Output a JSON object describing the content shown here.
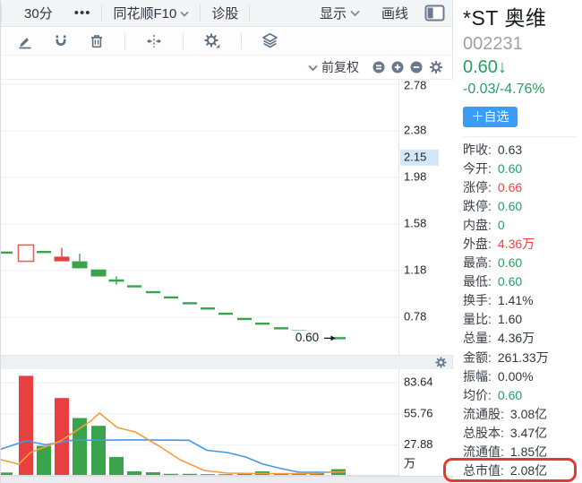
{
  "toolbar": {
    "interval": "30分",
    "more": "•••",
    "f10": "同花顺F10",
    "diagnose": "诊股",
    "display": "显示",
    "drawline": "画线",
    "draw_icons": [
      "pen-icon",
      "magnet-icon",
      "trash-icon",
      "split-arrows-icon",
      "gear-icon",
      "layers-icon"
    ]
  },
  "chart_header": {
    "adjust_label": "前复权",
    "zoom_icons": [
      "equals-circle-icon",
      "plus-circle-icon",
      "minus-circle-icon",
      "gear-icon"
    ]
  },
  "right_panel": {
    "name": "*ST 奥维",
    "code": "002231",
    "price": "0.60",
    "price_arrow": "↓",
    "change": "-0.03/-4.76%",
    "fav_button": "＋自选",
    "stats": [
      {
        "label": "昨收:",
        "value": "0.63",
        "color": "dark"
      },
      {
        "label": "今开:",
        "value": "0.60",
        "color": "green"
      },
      {
        "label": "涨停:",
        "value": "0.66",
        "color": "red"
      },
      {
        "label": "跌停:",
        "value": "0.60",
        "color": "green"
      },
      {
        "label": "内盘:",
        "value": "0",
        "color": "green"
      },
      {
        "label": "外盘:",
        "value": "4.36万",
        "color": "red"
      },
      {
        "label": "最高:",
        "value": "0.60",
        "color": "green"
      },
      {
        "label": "最低:",
        "value": "0.60",
        "color": "green"
      },
      {
        "label": "换手:",
        "value": "1.41%",
        "color": "dark"
      },
      {
        "label": "量比:",
        "value": "1.60",
        "color": "dark"
      },
      {
        "label": "总量:",
        "value": "4.36万",
        "color": "dark"
      },
      {
        "label": "金额:",
        "value": "261.33万",
        "color": "dark"
      },
      {
        "label": "振幅:",
        "value": "0.00%",
        "color": "dark"
      },
      {
        "label": "均价:",
        "value": "0.60",
        "color": "green"
      },
      {
        "label": "流通股:",
        "value": "3.08亿",
        "color": "dark"
      },
      {
        "label": "总股本:",
        "value": "3.47亿",
        "color": "dark"
      },
      {
        "label": "流通值:",
        "value": "1.85亿",
        "color": "dark"
      },
      {
        "label": "总市值:",
        "value": "2.08亿",
        "color": "dark",
        "highlighted": true
      }
    ]
  },
  "chart_data": [
    {
      "type": "candlestick",
      "pane": "price",
      "title": "30分钟K线 *ST奥维 002231 前复权",
      "y_ticks": [
        2.78,
        2.38,
        1.98,
        1.58,
        1.18,
        0.78
      ],
      "highlight_tick": 2.15,
      "annotation": {
        "text": "0.60"
      },
      "candles": [
        {
          "x": 5,
          "color": "g",
          "bt": 1.335,
          "bb": 1.335
        },
        {
          "x": 28,
          "color": "r",
          "hollow": true,
          "bt": 1.4,
          "bb": 1.26
        },
        {
          "x": 48,
          "color": "g",
          "bt": 1.34,
          "bb": 1.34
        },
        {
          "x": 68,
          "color": "r",
          "bt": 1.3,
          "bb": 1.26,
          "high": 1.375
        },
        {
          "x": 88,
          "color": "g",
          "bt": 1.26,
          "bb": 1.2,
          "high": 1.325
        },
        {
          "x": 109,
          "color": "g",
          "bt": 1.19,
          "bb": 1.13
        },
        {
          "x": 129,
          "color": "g",
          "bt": 1.105,
          "bb": 1.085,
          "high": 1.13,
          "low": 1.06
        },
        {
          "x": 149,
          "color": "g",
          "bt": 1.045,
          "bb": 1.045
        },
        {
          "x": 170,
          "color": "g",
          "bt": 0.995,
          "bb": 0.995
        },
        {
          "x": 190,
          "color": "g",
          "bt": 0.95,
          "bb": 0.95
        },
        {
          "x": 211,
          "color": "g",
          "bt": 0.9,
          "bb": 0.9
        },
        {
          "x": 231,
          "color": "g",
          "bt": 0.855,
          "bb": 0.855
        },
        {
          "x": 251,
          "color": "g",
          "bt": 0.81,
          "bb": 0.81
        },
        {
          "x": 272,
          "color": "g",
          "bt": 0.765,
          "bb": 0.765
        },
        {
          "x": 292,
          "color": "g",
          "bt": 0.725,
          "bb": 0.725
        },
        {
          "x": 313,
          "color": "g",
          "bt": 0.685,
          "bb": 0.685
        },
        {
          "x": 333,
          "color": "g",
          "bt": 0.66,
          "bb": 0.66
        },
        {
          "x": 353,
          "color": "g",
          "bt": 0.625,
          "bb": 0.625
        },
        {
          "x": 377,
          "color": "g",
          "bt": 0.6,
          "bb": 0.6,
          "last": true
        }
      ]
    },
    {
      "type": "bar",
      "pane": "volume",
      "title": "成交量",
      "unit": "万",
      "y_ticks": [
        83.64,
        55.76,
        27.88
      ],
      "bars": [
        {
          "x": 5,
          "v": 3,
          "color": "g"
        },
        {
          "x": 28,
          "v": 90,
          "color": "r"
        },
        {
          "x": 48,
          "v": 27,
          "color": "g"
        },
        {
          "x": 68,
          "v": 70,
          "color": "r"
        },
        {
          "x": 88,
          "v": 52,
          "color": "g"
        },
        {
          "x": 109,
          "v": 45,
          "color": "g"
        },
        {
          "x": 129,
          "v": 17,
          "color": "g"
        },
        {
          "x": 149,
          "v": 4,
          "color": "g"
        },
        {
          "x": 170,
          "v": 3.2,
          "color": "g"
        },
        {
          "x": 190,
          "v": 1.8,
          "color": "g"
        },
        {
          "x": 211,
          "v": 1.8,
          "color": "g"
        },
        {
          "x": 231,
          "v": 1.5,
          "color": "g"
        },
        {
          "x": 251,
          "v": 1.5,
          "color": "g"
        },
        {
          "x": 272,
          "v": 1.8,
          "color": "g"
        },
        {
          "x": 292,
          "v": 4,
          "color": "g"
        },
        {
          "x": 313,
          "v": 2.2,
          "color": "g"
        },
        {
          "x": 333,
          "v": 2.2,
          "color": "g"
        },
        {
          "x": 353,
          "v": 2.2,
          "color": "g"
        },
        {
          "x": 377,
          "v": 6,
          "color": "g"
        }
      ],
      "lines": [
        {
          "name": "ma-volume-blue",
          "color": "#4397ea",
          "points": [
            [
              0,
              24
            ],
            [
              28,
              31.5
            ],
            [
              50,
              28
            ],
            [
              80,
              32
            ],
            [
              150,
              32.3
            ],
            [
              210,
              32
            ],
            [
              230,
              23
            ],
            [
              253,
              21
            ],
            [
              273,
              17
            ],
            [
              293,
              10.5
            ],
            [
              313,
              6.5
            ],
            [
              333,
              3.2
            ],
            [
              360,
              3.2
            ],
            [
              385,
              3.6
            ]
          ]
        },
        {
          "name": "ma-volume-orange",
          "color": "#f79c3d",
          "points": [
            [
              0,
              14.5
            ],
            [
              20,
              10.5
            ],
            [
              33,
              21
            ],
            [
              67,
              31.5
            ],
            [
              100,
              49
            ],
            [
              110,
              56.5
            ],
            [
              130,
              43.5
            ],
            [
              150,
              39.5
            ],
            [
              177,
              26.6
            ],
            [
              200,
              14.5
            ],
            [
              227,
              4.8
            ],
            [
              253,
              2.4
            ],
            [
              300,
              2
            ],
            [
              350,
              2
            ],
            [
              367,
              3.2
            ],
            [
              385,
              3.6
            ]
          ]
        }
      ]
    }
  ],
  "colors": {
    "candle_green": "#3aa34b",
    "candle_red": "#e83f40",
    "hollow_red_stroke": "#e96062",
    "text_green": "#21a263",
    "text_red": "#f0413e",
    "accent_blue": "#3b9cf6",
    "slate_icon": "#64758a",
    "tick_highlight_bg": "#d3e7fb",
    "annotation_red": "#e23a2b"
  }
}
